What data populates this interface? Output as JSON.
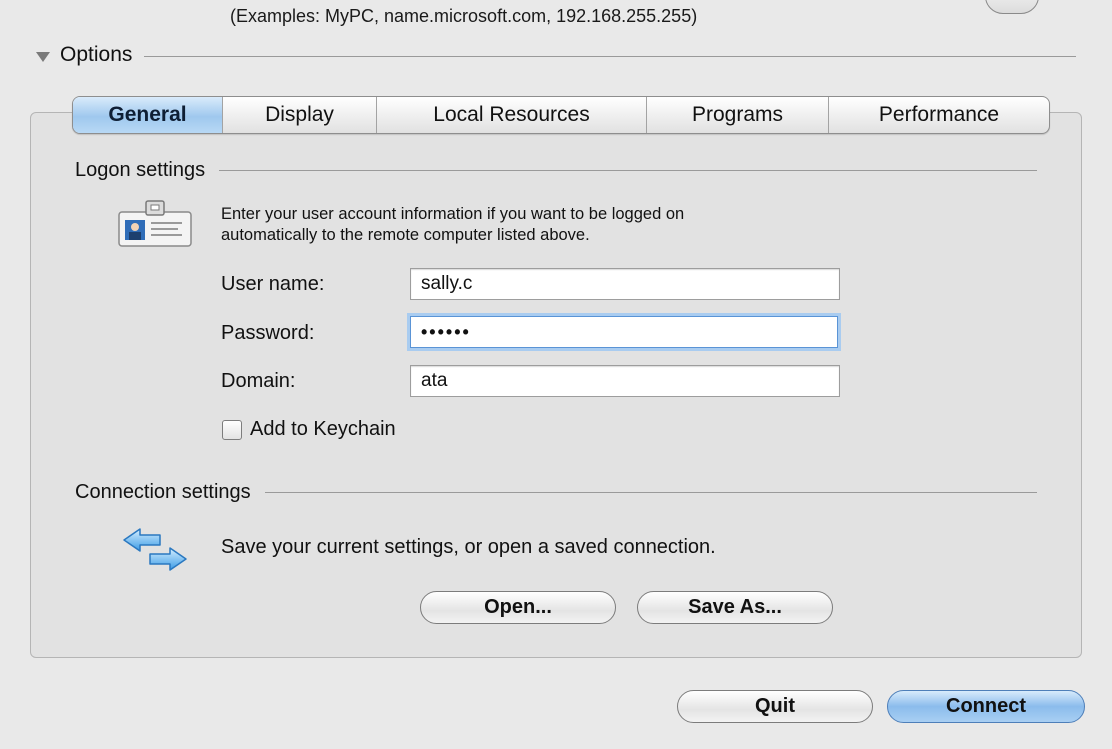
{
  "hint": "(Examples: MyPC, name.microsoft.com, 192.168.255.255)",
  "options": {
    "label": "Options",
    "icon": "disclosure-triangle-down"
  },
  "tabs": [
    {
      "label": "General",
      "selected": true
    },
    {
      "label": "Display",
      "selected": false
    },
    {
      "label": "Local Resources",
      "selected": false
    },
    {
      "label": "Programs",
      "selected": false
    },
    {
      "label": "Performance",
      "selected": false
    }
  ],
  "logon": {
    "section_label": "Logon settings",
    "icon": "id-badge-icon",
    "description_line1": "Enter your user account information if you want to be logged on",
    "description_line2": "automatically to the remote computer listed above.",
    "username_label": "User name:",
    "username_value": "sally.c",
    "password_label": "Password:",
    "password_value": "••••••",
    "domain_label": "Domain:",
    "domain_value": "ata",
    "keychain_label": "Add to Keychain",
    "keychain_checked": false
  },
  "connection": {
    "section_label": "Connection settings",
    "icon": "swap-arrows-icon",
    "description": "Save your current settings, or open a saved connection.",
    "open_label": "Open...",
    "save_as_label": "Save As..."
  },
  "footer": {
    "quit_label": "Quit",
    "connect_label": "Connect"
  },
  "colors": {
    "selected_tab": "#a9cff3",
    "focus_ring": "#a9ccf0",
    "default_button": "#8bbcec"
  }
}
